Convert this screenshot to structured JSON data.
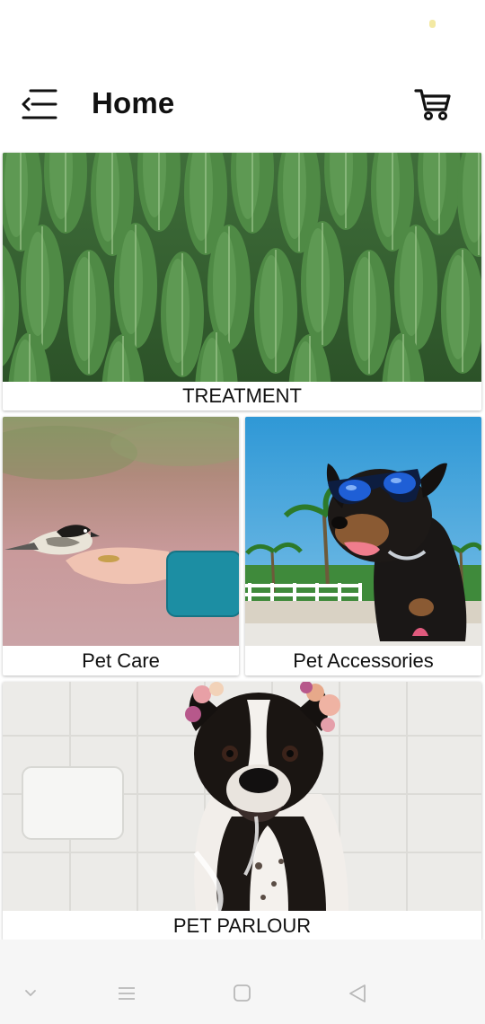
{
  "header": {
    "title": "Home"
  },
  "cards": [
    {
      "label": "TREATMENT"
    },
    {
      "label": "Pet Care"
    },
    {
      "label": "Pet Accessories"
    },
    {
      "label": "PET PARLOUR"
    }
  ],
  "icons": {
    "menu": "menu-back-icon",
    "cart": "cart-icon",
    "nav": [
      "chevron-down-icon",
      "recents-icon",
      "home-icon",
      "back-icon"
    ]
  },
  "colors": {
    "title": "#111111",
    "nav_background": "#f6f6f6",
    "nav_icon": "#b8b8b8"
  }
}
